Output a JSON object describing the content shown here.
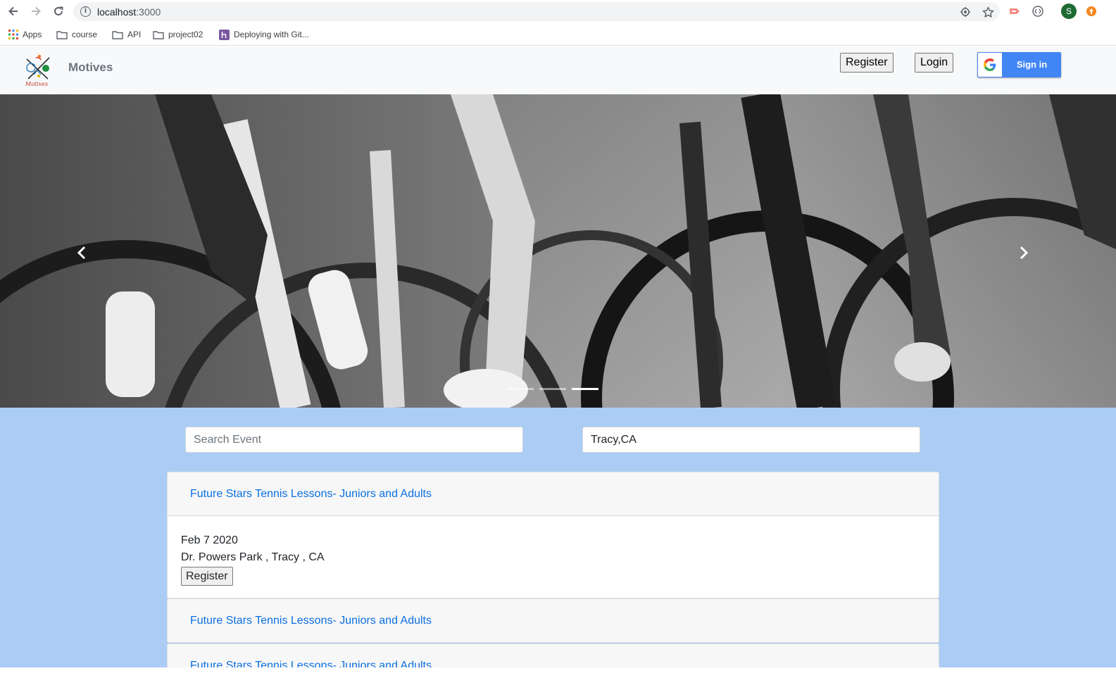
{
  "browser": {
    "url_host": "localhost",
    "url_port": ":3000",
    "profile_initial": "S",
    "bookmarks": [
      {
        "label": "Apps"
      },
      {
        "label": "course"
      },
      {
        "label": "API"
      },
      {
        "label": "project02"
      },
      {
        "label": "Deploying with Git..."
      }
    ]
  },
  "navbar": {
    "brand": "Motives",
    "logo_text": "Motives",
    "register_label": "Register",
    "login_label": "Login",
    "google_signin_label": "Sign in"
  },
  "hero": {
    "slide_count": 3,
    "active_slide": 3
  },
  "search": {
    "event_placeholder": "Search Event",
    "location_value": "Tracy,CA"
  },
  "events": [
    {
      "title": "Future Stars Tennis Lessons- Juniors and Adults",
      "date": "Feb 7 2020",
      "location": "Dr. Powers Park , Tracy , CA",
      "register_label": "Register",
      "expanded": true
    },
    {
      "title": "Future Stars Tennis Lessons- Juniors and Adults",
      "expanded": false
    },
    {
      "title": "Future Stars Tennis Lessons- Juniors and Adults",
      "expanded": false
    }
  ],
  "colors": {
    "page_background": "#abcdf5",
    "link": "#0b6fe0",
    "google_blue": "#4285f4"
  }
}
